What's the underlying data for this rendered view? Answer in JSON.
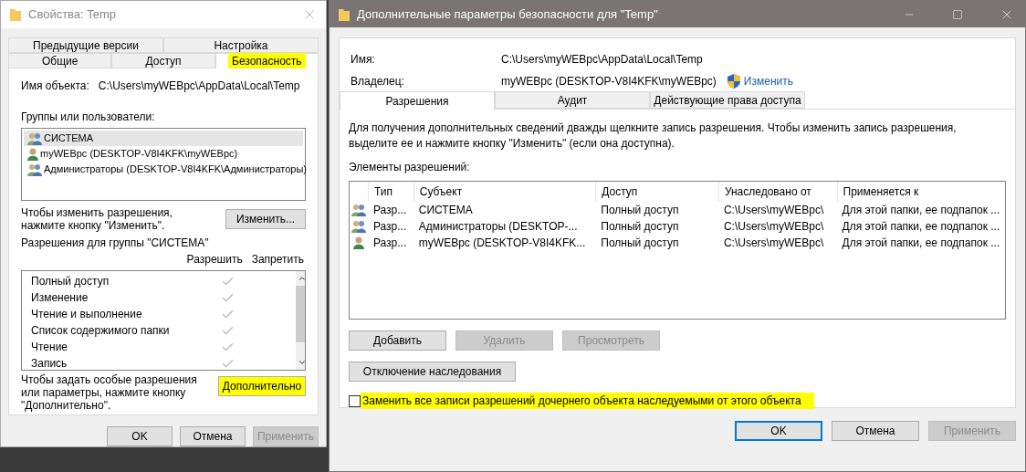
{
  "left_window": {
    "title": "Свойства: Temp",
    "tab_rows": [
      [
        {
          "label": "Предыдущие версии",
          "selected": false,
          "highlight": false
        },
        {
          "label": "Настройка",
          "selected": false,
          "highlight": false
        }
      ],
      [
        {
          "label": "Общие",
          "selected": false,
          "highlight": false
        },
        {
          "label": "Доступ",
          "selected": false,
          "highlight": false
        },
        {
          "label": "Безопасность",
          "selected": true,
          "highlight": true
        }
      ]
    ],
    "object_label": "Имя объекта:",
    "object_value": "C:\\Users\\myWEBpc\\AppData\\Local\\Temp",
    "groups_label": "Группы или пользователи:",
    "users": [
      {
        "kind": "group",
        "name": "СИСТЕМА",
        "selected": true
      },
      {
        "kind": "user",
        "name": "myWEBpc (DESKTOP-V8I4KFK\\myWEBpc)",
        "selected": false
      },
      {
        "kind": "group",
        "name": "Администраторы (DESKTOP-V8I4KFK\\Администраторы)",
        "selected": false
      }
    ],
    "change_hint": "Чтобы изменить разрешения, нажмите кнопку \"Изменить\".",
    "change_button": "Изменить...",
    "permissions_label": "Разрешения для группы \"СИСТЕМА\"",
    "columns": [
      "Разрешить",
      "Запретить"
    ],
    "permissions": [
      {
        "name": "Полный доступ",
        "allow": true
      },
      {
        "name": "Изменение",
        "allow": true
      },
      {
        "name": "Чтение и выполнение",
        "allow": true
      },
      {
        "name": "Список содержимого папки",
        "allow": true
      },
      {
        "name": "Чтение",
        "allow": true
      },
      {
        "name": "Запись",
        "allow": true
      }
    ],
    "special_hint": "Чтобы задать особые разрешения или параметры, нажмите кнопку \"Дополнительно\".",
    "advanced_button": {
      "label": "Дополнительно",
      "highlight": true
    },
    "buttons": [
      {
        "label": "OK",
        "disabled": false
      },
      {
        "label": "Отмена",
        "disabled": false
      },
      {
        "label": "Применить",
        "disabled": true
      }
    ]
  },
  "right_window": {
    "title": "Дополнительные параметры безопасности  для \"Temp\"",
    "name_label": "Имя:",
    "name_value": "C:\\Users\\myWEBpc\\AppData\\Local\\Temp",
    "owner_label": "Владелец:",
    "owner_value": "myWEBpc (DESKTOP-V8I4KFK\\myWEBpc)",
    "owner_link": "Изменить",
    "tabs": [
      {
        "label": "Разрешения",
        "selected": true
      },
      {
        "label": "Аудит",
        "selected": false
      },
      {
        "label": "Действующие права доступа",
        "selected": false
      }
    ],
    "info": "Для получения дополнительных сведений дважды щелкните запись разрешения. Чтобы изменить запись разрешения, выделите ее и нажмите кнопку \"Изменить\" (если она доступна).",
    "entries_label": "Элементы разрешений:",
    "columns": [
      "Тип",
      "Субъект",
      "Доступ",
      "Унаследовано от",
      "Применяется к"
    ],
    "rows": [
      {
        "kind": "group",
        "cells": [
          "Разр...",
          "СИСТЕМА",
          "Полный доступ",
          "C:\\Users\\myWEBpc\\",
          "Для этой папки, ее подпапок ..."
        ]
      },
      {
        "kind": "group",
        "cells": [
          "Разр...",
          "Администраторы (DESKTOP-...",
          "Полный доступ",
          "C:\\Users\\myWEBpc\\",
          "Для этой папки, ее подпапок ..."
        ]
      },
      {
        "kind": "user",
        "cells": [
          "Разр...",
          "myWEBpc (DESKTOP-V8I4KFK...",
          "Полный доступ",
          "C:\\Users\\myWEBpc\\",
          "Для этой папки, ее подпапок ..."
        ]
      }
    ],
    "entry_buttons": [
      {
        "label": "Добавить",
        "disabled": false
      },
      {
        "label": "Удалить",
        "disabled": true
      },
      {
        "label": "Просмотреть",
        "disabled": true
      }
    ],
    "inheritance_button": "Отключение наследования",
    "replace_checkbox": {
      "label": "Заменить все записи разрешений дочернего объекта наследуемыми от этого объекта",
      "checked": false,
      "highlight": true
    },
    "buttons": [
      {
        "label": "OK",
        "disabled": false,
        "default": true
      },
      {
        "label": "Отмена",
        "disabled": false,
        "default": false
      },
      {
        "label": "Применить",
        "disabled": true,
        "default": false
      }
    ]
  }
}
